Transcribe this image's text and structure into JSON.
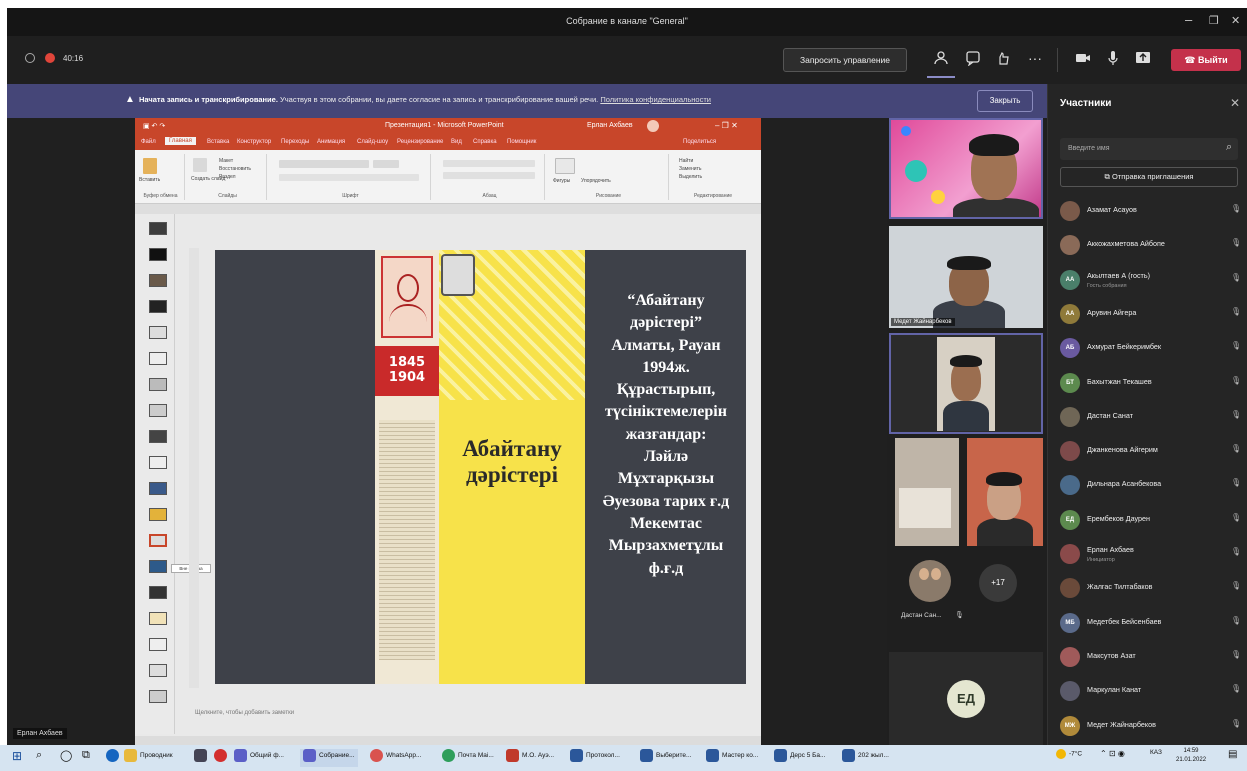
{
  "window": {
    "title": "Собрание в канале \"General\"",
    "minimize": "–",
    "maximize": "❐",
    "close": "✕"
  },
  "toolbar": {
    "timer": "40:16",
    "request_control": "Запросить управление",
    "more": "···",
    "leave": "Выйти"
  },
  "banner": {
    "bold": "Начата запись и транскрибирование.",
    "text": " Участвуя в этом собрании, вы даете согласие на запись и транскрибирование вашей речи. ",
    "link": "Политика конфиденциальности",
    "close": "Закрыть"
  },
  "ppt": {
    "title": "Презентация1 - Microsoft PowerPoint",
    "user": "Ерлан Ахбаев",
    "tabs": [
      "Файл",
      "Главная",
      "Вставка",
      "Конструктор",
      "Переходы",
      "Анимация",
      "Слайд-шоу",
      "Рецензирование",
      "Вид",
      "Справка",
      "Помощник"
    ],
    "share": "Поделиться",
    "ribbon": {
      "paste": "Вставить",
      "create_slide": "Создать слайд",
      "layout": "Макет",
      "reset": "Восстановить",
      "section": "Раздел",
      "groups": [
        "Буфер обмена",
        "Слайды",
        "Шрифт",
        "Абзац",
        "Рисование",
        "Редактирование"
      ],
      "shapes": "Фигуры",
      "arrange": "Упорядочить",
      "find": "Найти",
      "replace": "Заменить",
      "select": "Выделить"
    },
    "thumb_tooltip": "Вне показа",
    "notes": "Щелкните, чтобы добавить заметки"
  },
  "slide": {
    "cover_years": [
      "1845",
      "1904"
    ],
    "cover_title": [
      "Абайтану",
      "дәрістері"
    ],
    "text_lines": [
      "“Абайтану",
      "дәрістері”",
      "Алматы,  Рауан",
      "1994ж.",
      "Құрастырып,",
      "түсініктемелерін",
      "жазғандар:",
      "Ләйлә",
      "Мұхтарқызы",
      "Әуезова тарих ғ.д",
      "Мекемтас",
      "Мырзахметұлы",
      "ф.ғ.д"
    ]
  },
  "presenter": "Ерлан Ахбаев",
  "videos": {
    "tile2_name": "Медет Жайнарбеков",
    "group_name": "Дастан Сан...",
    "more_count": "+17",
    "ed_initials": "ЕД"
  },
  "panel": {
    "title": "Участники",
    "search_placeholder": "Введите имя",
    "invite": "Отправка приглашения",
    "participants": [
      {
        "name": "Азамат Асауов",
        "initials": "",
        "color": "#7a5a4a",
        "sub": ""
      },
      {
        "name": "Аккожахметова Айбопе",
        "initials": "",
        "color": "#8a6a58",
        "sub": ""
      },
      {
        "name": "Акылтаев А (гость)",
        "initials": "АА",
        "color": "#4a7f6a",
        "sub": "Гость собрания"
      },
      {
        "name": "Арувин Айгера",
        "initials": "АА",
        "color": "#8f7a3a",
        "sub": ""
      },
      {
        "name": "Ахмурат Бейкеримбек",
        "initials": "АБ",
        "color": "#6a5aa0",
        "sub": ""
      },
      {
        "name": "Бахытжан Текашев",
        "initials": "БТ",
        "color": "#5c8a4e",
        "sub": ""
      },
      {
        "name": "Дастан Санат",
        "initials": "",
        "color": "#6f6656",
        "sub": ""
      },
      {
        "name": "Джанкенова Айгерим",
        "initials": "",
        "color": "#7d4a4a",
        "sub": ""
      },
      {
        "name": "Дильнара Асанбекова",
        "initials": "",
        "color": "#4a6a8a",
        "sub": ""
      },
      {
        "name": "Ерембеков Даурен",
        "initials": "ЕД",
        "color": "#5c8a4e",
        "sub": ""
      },
      {
        "name": "Ерлан Ахбаев",
        "initials": "",
        "color": "#8a4a4a",
        "sub": "Инициатор"
      },
      {
        "name": "Жалгас Тилтабаков",
        "initials": "",
        "color": "#6a4a3a",
        "sub": ""
      },
      {
        "name": "Медетбек Бейсенбаев",
        "initials": "МБ",
        "color": "#5a6a8a",
        "sub": ""
      },
      {
        "name": "Максутов Азат",
        "initials": "",
        "color": "#a05a5a",
        "sub": ""
      },
      {
        "name": "Маркулан Канат",
        "initials": "",
        "color": "#5a5a6a",
        "sub": ""
      },
      {
        "name": "Медет Жайнарбеков",
        "initials": "МЖ",
        "color": "#b08a3a",
        "sub": ""
      }
    ]
  },
  "taskbar": {
    "apps": [
      "Проводник",
      "Общий ф...",
      "Собрание...",
      "WhatsApp...",
      "Почта Mai...",
      "М.О. Ауэ...",
      "Протокол...",
      "Выберите...",
      "Мастер ко...",
      "Дерс 5 Ба...",
      "202 жыл..."
    ],
    "weather": "-7°C",
    "lang": "КАЗ",
    "time": "14:59",
    "date": "21.01.2022"
  },
  "colors": {
    "teams_bg": "#1f1f1f",
    "banner": "#454678",
    "leave": "#c4314b",
    "ppt_accent": "#c8462a",
    "selected_tile": "#6264a7"
  }
}
